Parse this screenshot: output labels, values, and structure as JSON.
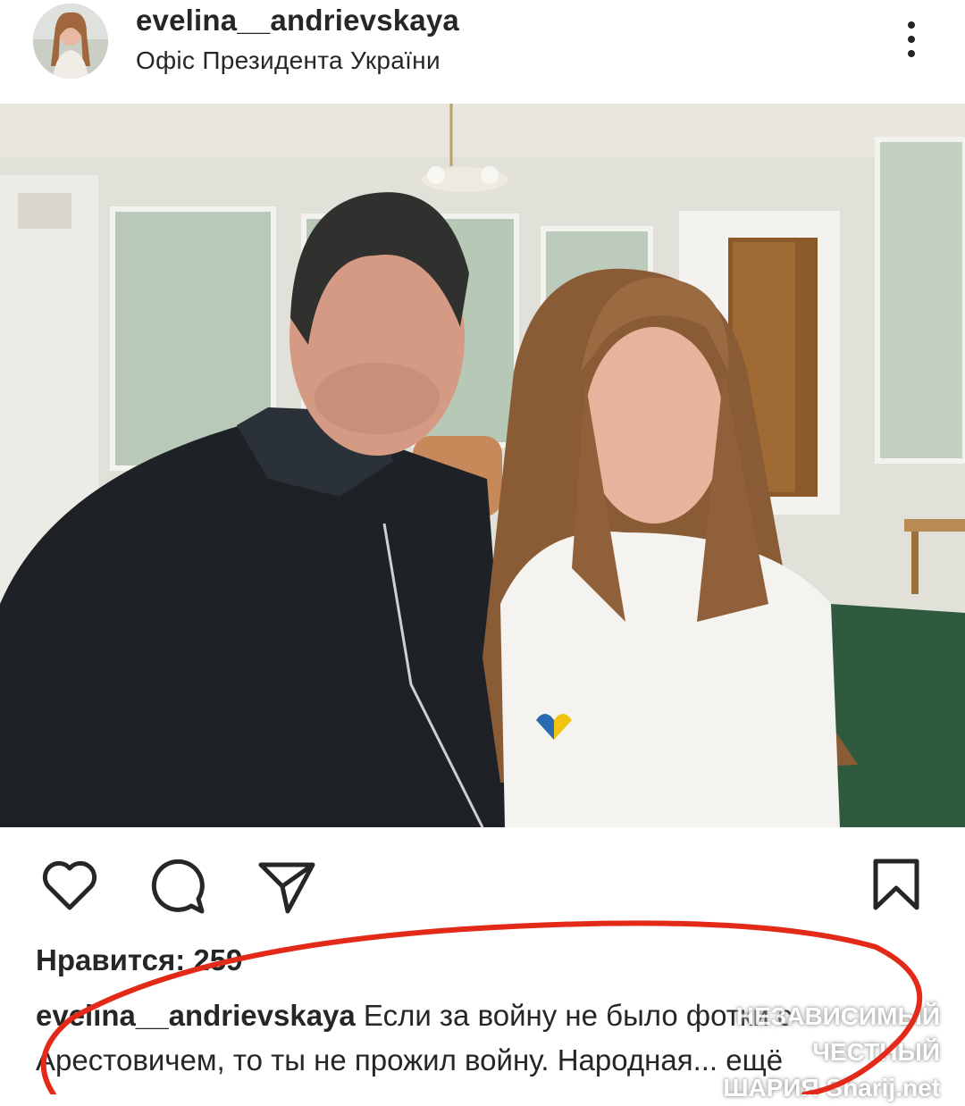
{
  "post": {
    "username": "evelina__andrievskaya",
    "location": "Офіс Президента України",
    "likes_label": "Нравится: 259",
    "caption_user": "evelina__andrievskaya",
    "caption_text": " Если за войну не было фотки с Арестовичем, то ты не прожил войну. Народная... ещё"
  },
  "watermark": {
    "line1": "НЕЗАВИСИМЫЙ ЧЕСТНЫЙ",
    "line2": "ШАРИЯ Sharij.net"
  },
  "icons": {
    "more": "more-vertical-icon",
    "like": "heart-icon",
    "comment": "comment-icon",
    "share": "send-icon",
    "save": "bookmark-icon"
  },
  "colors": {
    "text": "#262626",
    "annotation": "#e32a18"
  }
}
